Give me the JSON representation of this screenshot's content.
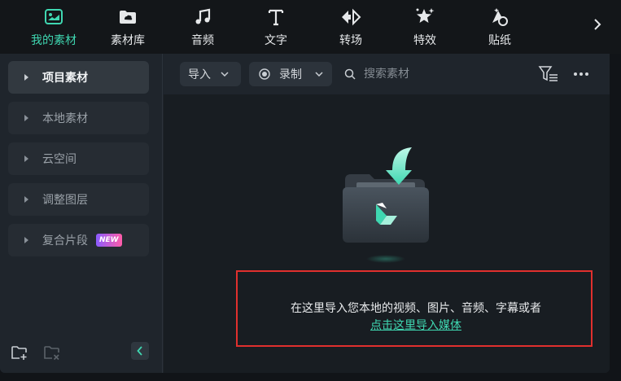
{
  "toolbar": {
    "items": [
      {
        "label": "我的素材",
        "icon": "my-media-icon",
        "active": true
      },
      {
        "label": "素材库",
        "icon": "stock-media-icon",
        "active": false
      },
      {
        "label": "音频",
        "icon": "music-note-icon",
        "active": false
      },
      {
        "label": "文字",
        "icon": "text-icon",
        "active": false
      },
      {
        "label": "转场",
        "icon": "transition-icon",
        "active": false
      },
      {
        "label": "特效",
        "icon": "effects-icon",
        "active": false
      },
      {
        "label": "贴纸",
        "icon": "sticker-icon",
        "active": false
      }
    ],
    "next_icon": "chevron-right-icon"
  },
  "sidebar": {
    "items": [
      {
        "label": "项目素材",
        "active": true
      },
      {
        "label": "本地素材",
        "active": false
      },
      {
        "label": "云空间",
        "active": false
      },
      {
        "label": "调整图层",
        "active": false
      },
      {
        "label": "复合片段",
        "active": false,
        "badge": "NEW"
      }
    ]
  },
  "content": {
    "import_label": "导入",
    "record_label": "录制",
    "search_placeholder": "搜索素材",
    "empty_hint": "在这里导入您本地的视频、图片、音频、字幕或者",
    "empty_link": "点击这里导入媒体"
  },
  "colors": {
    "accent": "#3fd7b1",
    "highlight_border": "#e0302e",
    "panel_bg": "#1f252c"
  }
}
